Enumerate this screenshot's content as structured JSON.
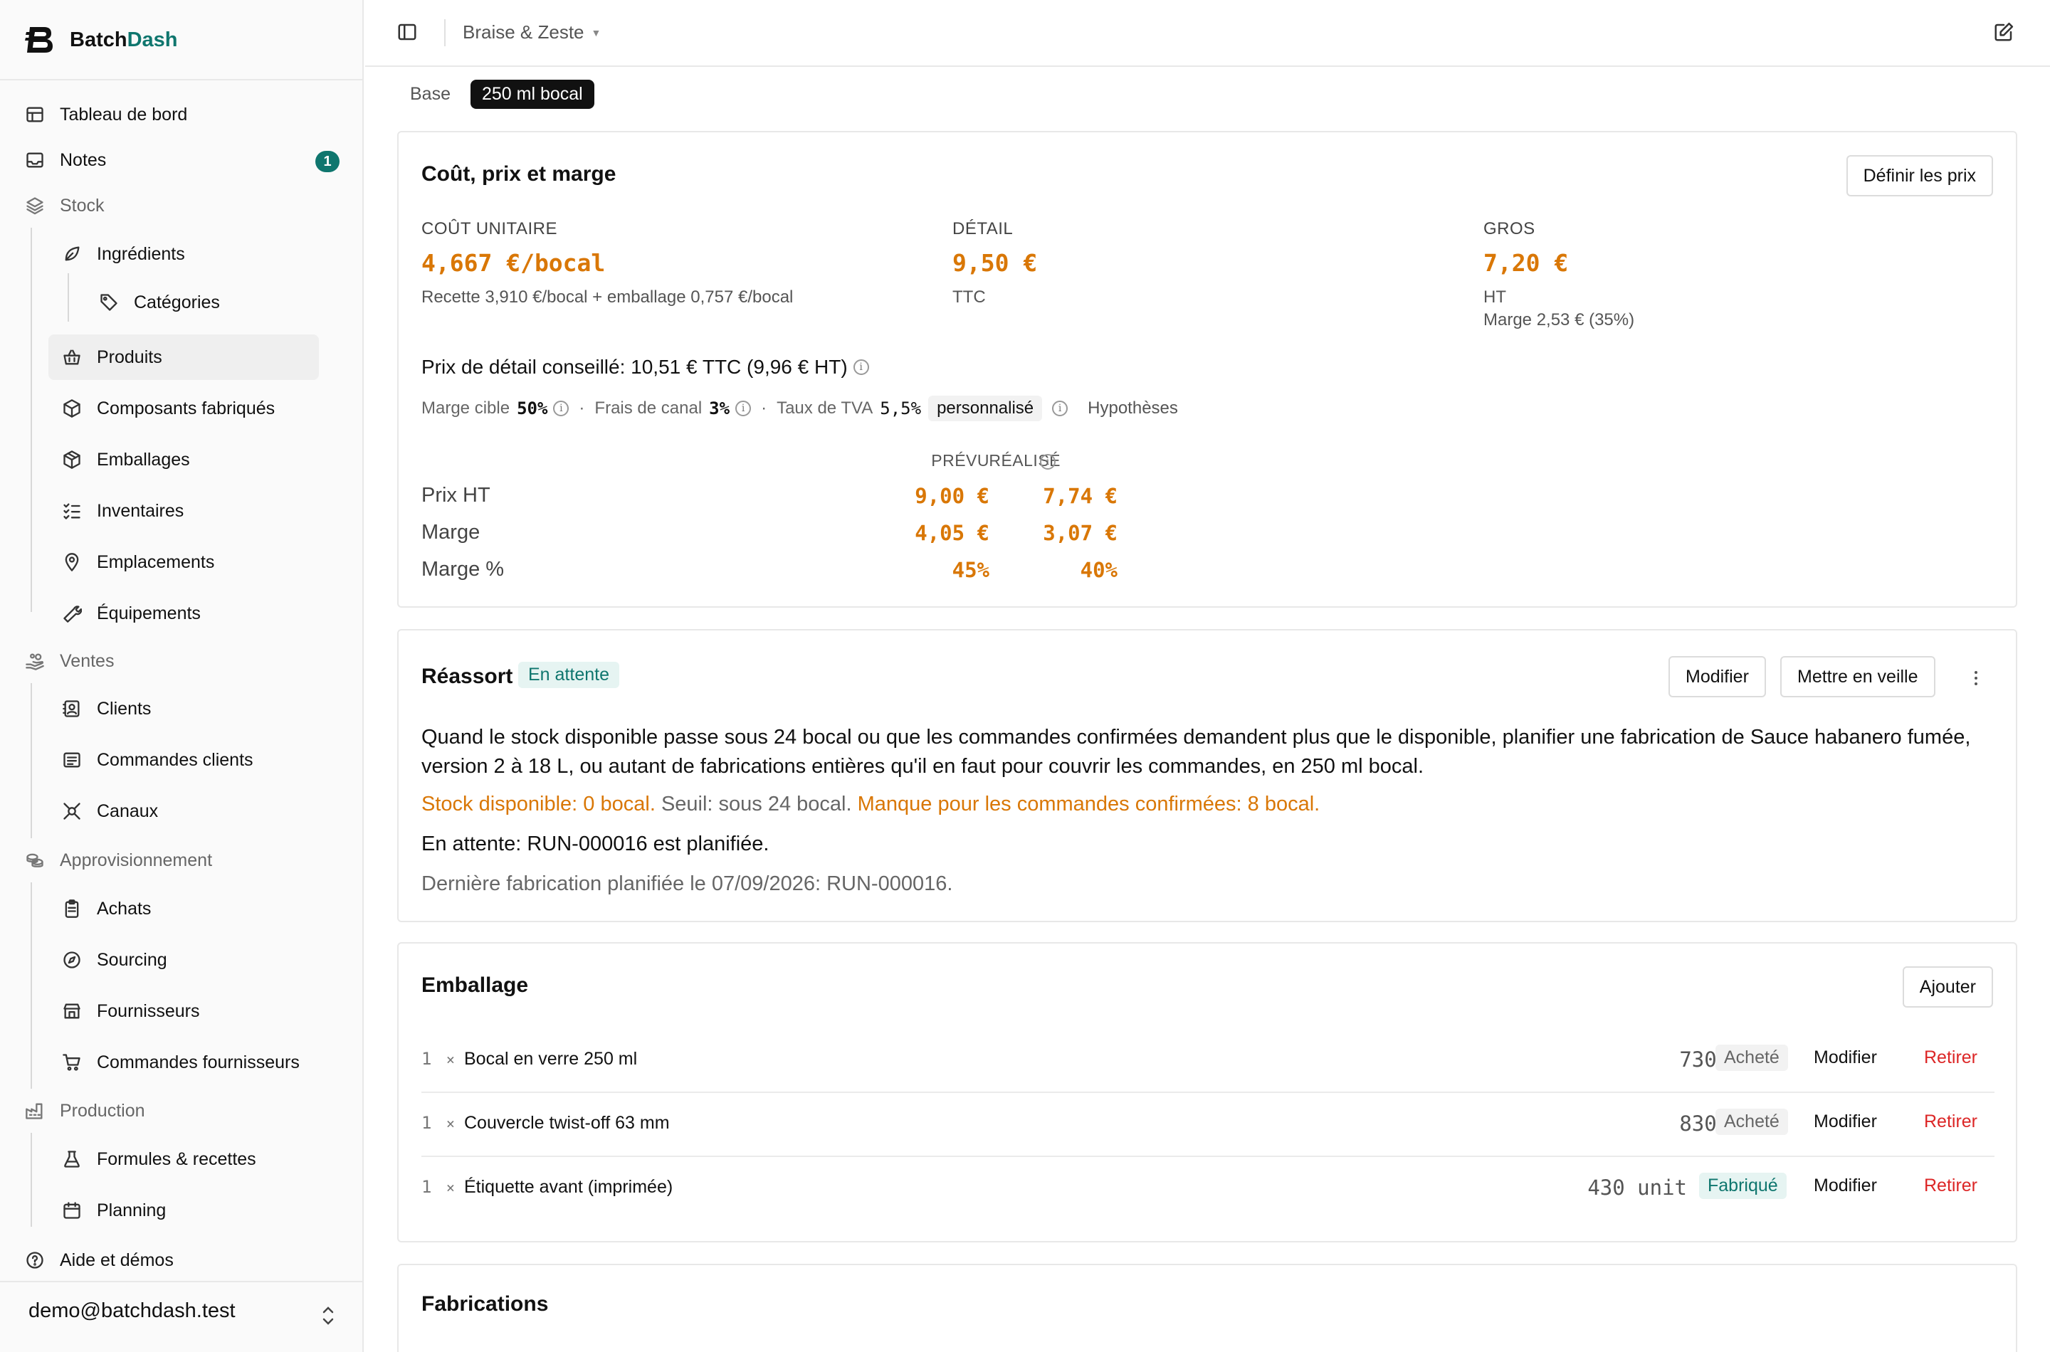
{
  "brand": {
    "name_part1": "Batch",
    "name_part2": "Dash"
  },
  "sidebar": {
    "items": [
      {
        "label": "Tableau de bord",
        "icon": "table-icon"
      },
      {
        "label": "Notes",
        "icon": "inbox-icon",
        "badge": "1"
      },
      {
        "label": "Stock",
        "icon": "layers-icon"
      },
      {
        "label": "Ingrédients",
        "icon": "leaf-icon"
      },
      {
        "label": "Catégories",
        "icon": "tag-icon"
      },
      {
        "label": "Produits",
        "icon": "basket-icon"
      },
      {
        "label": "Composants fabriqués",
        "icon": "cube-icon"
      },
      {
        "label": "Emballages",
        "icon": "package-icon"
      },
      {
        "label": "Inventaires",
        "icon": "checklist-icon"
      },
      {
        "label": "Emplacements",
        "icon": "map-pin-icon"
      },
      {
        "label": "Équipements",
        "icon": "wrench-icon"
      },
      {
        "label": "Ventes",
        "icon": "hand-coins-icon"
      },
      {
        "label": "Clients",
        "icon": "contact-icon"
      },
      {
        "label": "Commandes clients",
        "icon": "list-icon"
      },
      {
        "label": "Canaux",
        "icon": "plug-icon"
      },
      {
        "label": "Approvisionnement",
        "icon": "coins-icon"
      },
      {
        "label": "Achats",
        "icon": "clipboard-icon"
      },
      {
        "label": "Sourcing",
        "icon": "compass-icon"
      },
      {
        "label": "Fournisseurs",
        "icon": "store-icon"
      },
      {
        "label": "Commandes fournisseurs",
        "icon": "cart-icon"
      },
      {
        "label": "Production",
        "icon": "factory-icon"
      },
      {
        "label": "Formules & recettes",
        "icon": "flask-icon"
      },
      {
        "label": "Planning",
        "icon": "calendar-icon"
      },
      {
        "label": "Aide et démos",
        "icon": "help-circle-icon"
      }
    ],
    "user_email": "demo@batchdash.test"
  },
  "topbar": {
    "workspace": "Braise & Zeste"
  },
  "tabs": [
    "Base",
    "250 ml bocal"
  ],
  "cost_card": {
    "title": "Coût, prix et marge",
    "button": "Définir les prix",
    "unit_cost": {
      "label": "COÛT UNITAIRE",
      "value": "4,667 €/bocal",
      "sub": "Recette 3,910 €/bocal + emballage 0,757 €/bocal"
    },
    "retail": {
      "label": "DÉTAIL",
      "value": "9,50 €",
      "sub": "TTC"
    },
    "wholesale": {
      "label": "GROS",
      "value": "7,20 €",
      "sub": "HT",
      "sub2": "Marge 2,53 € (35%)"
    },
    "suggested": "Prix de détail conseillé: 10,51 € TTC (9,96 € HT)",
    "assumptions": {
      "target_margin_label": "Marge cible",
      "target_margin": "50%",
      "channel_fees_label": "Frais de canal",
      "channel_fees": "3%",
      "vat_label": "Taux de TVA",
      "vat": "5,5%",
      "custom": "personnalisé",
      "link": "Hypothèses",
      "dot": "·"
    },
    "table": {
      "col_planned": "PRÉVU",
      "col_actual": "RÉALISÉ",
      "rows": [
        {
          "label": "Prix HT",
          "planned": "9,00 €",
          "actual": "7,74 €"
        },
        {
          "label": "Marge",
          "planned": "4,05 €",
          "actual": "3,07 €"
        },
        {
          "label": "Marge %",
          "planned": "45%",
          "actual": "40%"
        }
      ]
    }
  },
  "restock_card": {
    "title": "Réassort",
    "status": "En attente",
    "btn_edit": "Modifier",
    "btn_pause": "Mettre en veille",
    "description": "Quand le stock disponible passe sous 24 bocal ou que les commandes confirmées demandent plus que le disponible, planifier une fabrication de Sauce habanero fumée, version 2 à 18 L, ou autant de fabrications entières qu'il en faut pour couvrir les commandes, en 250 ml bocal.",
    "stock_available": "Stock disponible: 0 bocal.",
    "threshold": "Seuil: sous 24 bocal.",
    "shortage": "Manque pour les commandes confirmées: 8 bocal.",
    "pending": "En attente: RUN-000016 est planifiée.",
    "last_run": "Dernière fabrication planifiée le 07/09/2026: RUN-000016."
  },
  "packaging_card": {
    "title": "Emballage",
    "button": "Ajouter",
    "rows": [
      {
        "qty": "1",
        "times": "×",
        "name": "Bocal en verre 250 ml",
        "stock": "730 unit",
        "tag": "Acheté",
        "edit": "Modifier",
        "remove": "Retirer"
      },
      {
        "qty": "1",
        "times": "×",
        "name": "Couvercle twist-off 63 mm",
        "stock": "830 unit",
        "tag": "Acheté",
        "edit": "Modifier",
        "remove": "Retirer"
      },
      {
        "qty": "1",
        "times": "×",
        "name": "Étiquette avant (imprimée)",
        "stock": "430 unit",
        "tag": "Fabriqué",
        "edit": "Modifier",
        "remove": "Retirer"
      }
    ]
  },
  "runs_card": {
    "title": "Fabrications"
  },
  "colors": {
    "accent": "#0f766e",
    "value_orange": "#d97706",
    "danger": "#dc2626"
  }
}
